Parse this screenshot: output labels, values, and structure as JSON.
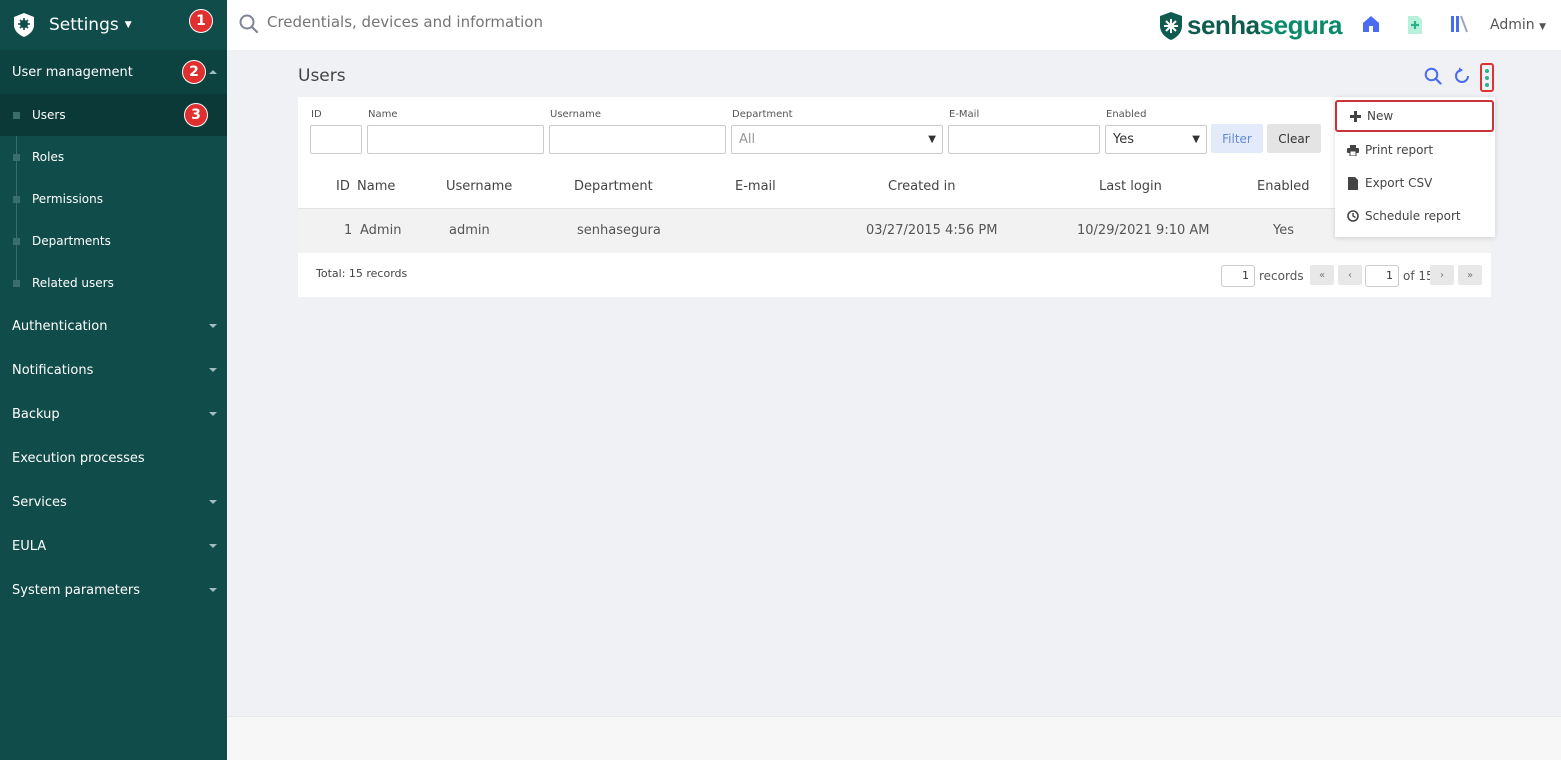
{
  "sidebar": {
    "title": "Settings",
    "badges": [
      "1",
      "2",
      "3"
    ],
    "sections": [
      {
        "label": "User management"
      },
      {
        "label": "Authentication"
      },
      {
        "label": "Notifications"
      },
      {
        "label": "Backup"
      },
      {
        "label": "Execution processes"
      },
      {
        "label": "Services"
      },
      {
        "label": "EULA"
      },
      {
        "label": "System parameters"
      }
    ],
    "subitems": [
      "Users",
      "Roles",
      "Permissions",
      "Departments",
      "Related users"
    ]
  },
  "topbar": {
    "search_placeholder": "Credentials, devices and information",
    "brand_a": "senha",
    "brand_b": "segura",
    "user": "Admin"
  },
  "page": {
    "title": "Users"
  },
  "filters": {
    "id_label": "ID",
    "name_label": "Name",
    "username_label": "Username",
    "department_label": "Department",
    "department_value": "All",
    "email_label": "E-Mail",
    "enabled_label": "Enabled",
    "enabled_value": "Yes",
    "filter_button": "Filter",
    "clear_button": "Clear"
  },
  "table": {
    "headers": [
      "ID",
      "Name",
      "Username",
      "Department",
      "E-mail",
      "Created in",
      "Last login",
      "Enabled"
    ],
    "rows": [
      {
        "id": "1",
        "name": "Admin",
        "username": "admin",
        "department": "senhasegura",
        "email": "",
        "created": "03/27/2015 4:56 PM",
        "last_login": "10/29/2021 9:10 AM",
        "enabled": "Yes"
      }
    ]
  },
  "footer": {
    "total": "Total: 15 records",
    "records_per_page": "1",
    "records_label": "records",
    "current_page": "1",
    "of_pages": "of 15",
    "first": "«",
    "prev": "‹",
    "next": "›",
    "last": "»"
  },
  "menu": {
    "items": [
      "New",
      "Print report",
      "Export CSV",
      "Schedule report"
    ]
  },
  "colors": {
    "sidebar": "#0f4c4a",
    "accent": "#2bb28a",
    "highlight": "#c9343a",
    "icon_blue": "#4a6cf0"
  }
}
